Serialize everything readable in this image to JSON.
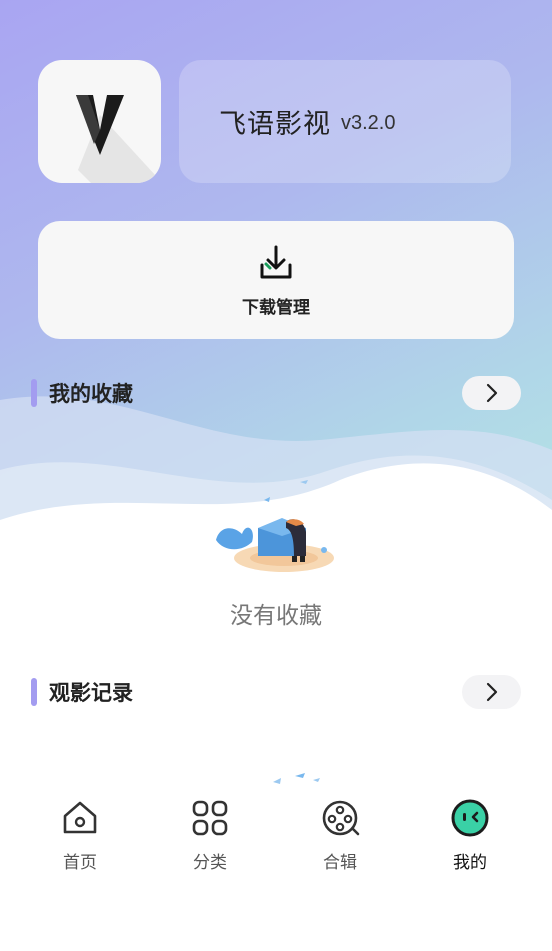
{
  "app": {
    "name": "飞语影视",
    "version": "v3.2.0",
    "logo_letter": "V"
  },
  "download": {
    "label": "下载管理"
  },
  "favorites": {
    "title": "我的收藏",
    "empty_text": "没有收藏"
  },
  "history": {
    "title": "观影记录"
  },
  "tabs": [
    {
      "label": "首页",
      "icon": "home-icon",
      "active": false
    },
    {
      "label": "分类",
      "icon": "grid-icon",
      "active": false
    },
    {
      "label": "合辑",
      "icon": "film-reel-icon",
      "active": false
    },
    {
      "label": "我的",
      "icon": "profile-face-icon",
      "active": true
    }
  ],
  "colors": {
    "accent": "#a39cf0",
    "active_tab": "#3ad1a6",
    "download_arrow": "#1a9e5c"
  }
}
